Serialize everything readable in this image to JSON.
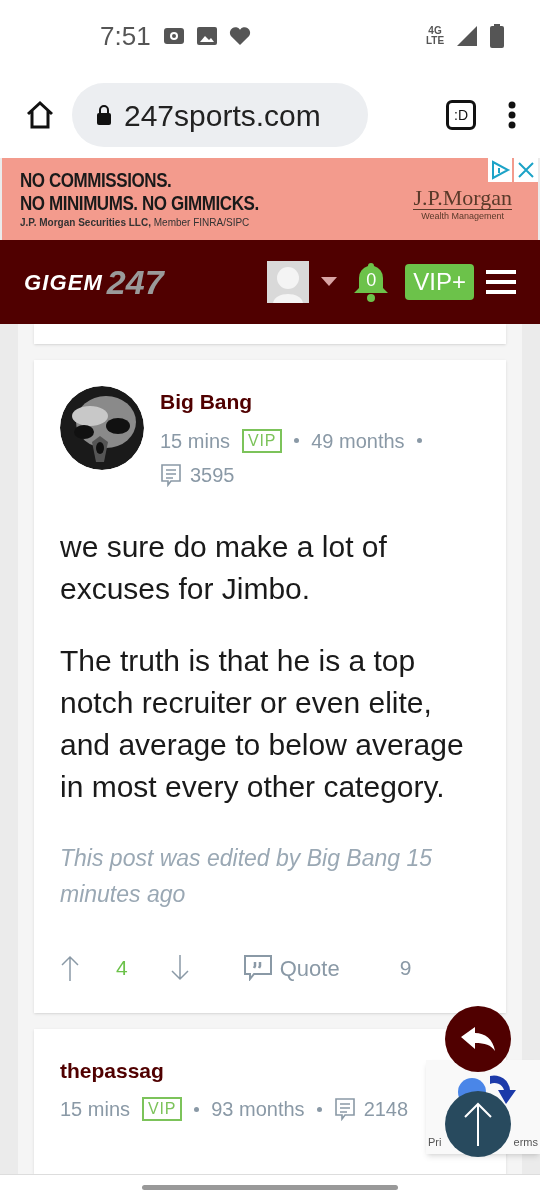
{
  "status_bar": {
    "time": "7:51",
    "network": "4G LTE"
  },
  "browser": {
    "url": "247sports.com",
    "tab_label": ":D"
  },
  "ad": {
    "line_1": "NO COMMISSIONS.",
    "line_2": "NO MINIMUMS. NO GIMMICKS.",
    "disclaimer_bold": "J.P. Morgan Securities LLC,",
    "disclaimer": "Member FINRA/SIPC",
    "brand": "J.P.Morgan",
    "brand_sub": "Wealth Management"
  },
  "site_nav": {
    "logo_word": "GIGEM",
    "logo_number": "247",
    "notifications": "0",
    "vip_label": "VIP+"
  },
  "posts": [
    {
      "author": "Big Bang",
      "time": "15 mins",
      "badge": "VIP",
      "tenure": "49 months",
      "post_count": "3595",
      "paragraphs": [
        "we sure do make a lot of excuses for Jimbo.",
        "The truth is that he is a top notch recruiter or even elite, and average to below average in most every other category."
      ],
      "edit_note": "This post was edited by Big Bang 15 minutes ago",
      "votes": "4",
      "quote_label": "Quote",
      "cut_text": "9"
    },
    {
      "author": "thepassag",
      "time": "15 mins",
      "badge": "VIP",
      "tenure": "93 months",
      "post_count": "2148"
    }
  ],
  "recaptcha": {
    "left_text": "Pri",
    "right_text": "erms"
  }
}
